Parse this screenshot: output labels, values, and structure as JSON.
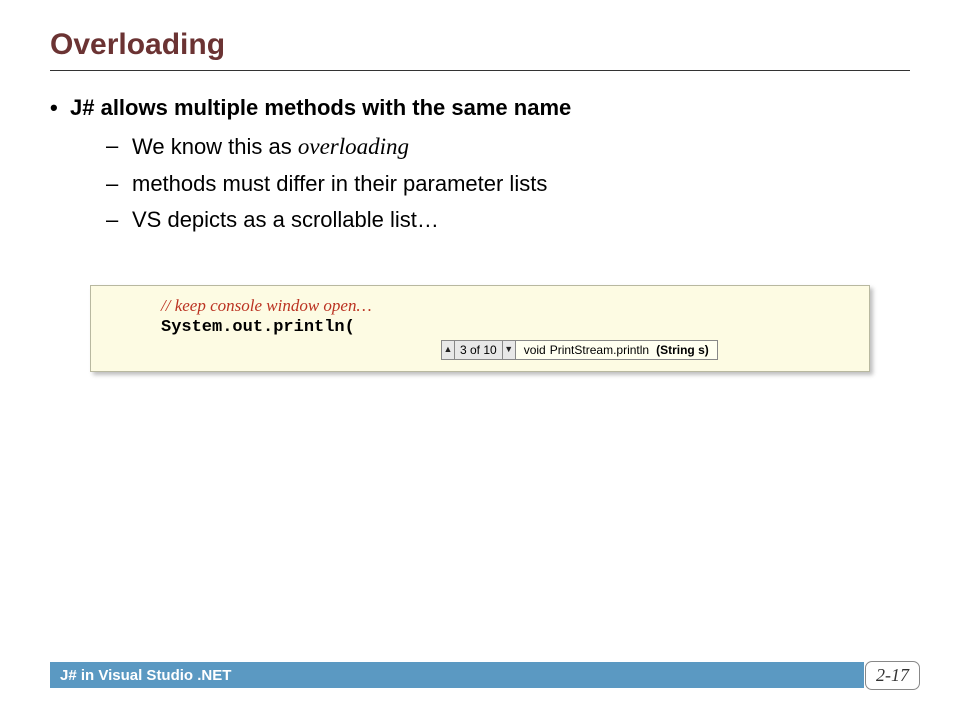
{
  "title": "Overloading",
  "bullets": {
    "main": "J# allows multiple methods with the same name",
    "subs": [
      {
        "prefix": "We know this as ",
        "italic": "overloading"
      },
      {
        "text": "methods must differ in their parameter lists"
      },
      {
        "text": "VS depicts as a scrollable list…"
      }
    ]
  },
  "code": {
    "comment": "// keep console window open…",
    "line": "System.out.println("
  },
  "intellisense": {
    "position": "3 of 10",
    "sig_ret": "void",
    "sig_cls": "PrintStream.println",
    "sig_param": "(String s)",
    "up_glyph": "▲",
    "down_glyph": "▼"
  },
  "footer": {
    "label": "J# in Visual Studio .NET",
    "page": "2-17"
  }
}
